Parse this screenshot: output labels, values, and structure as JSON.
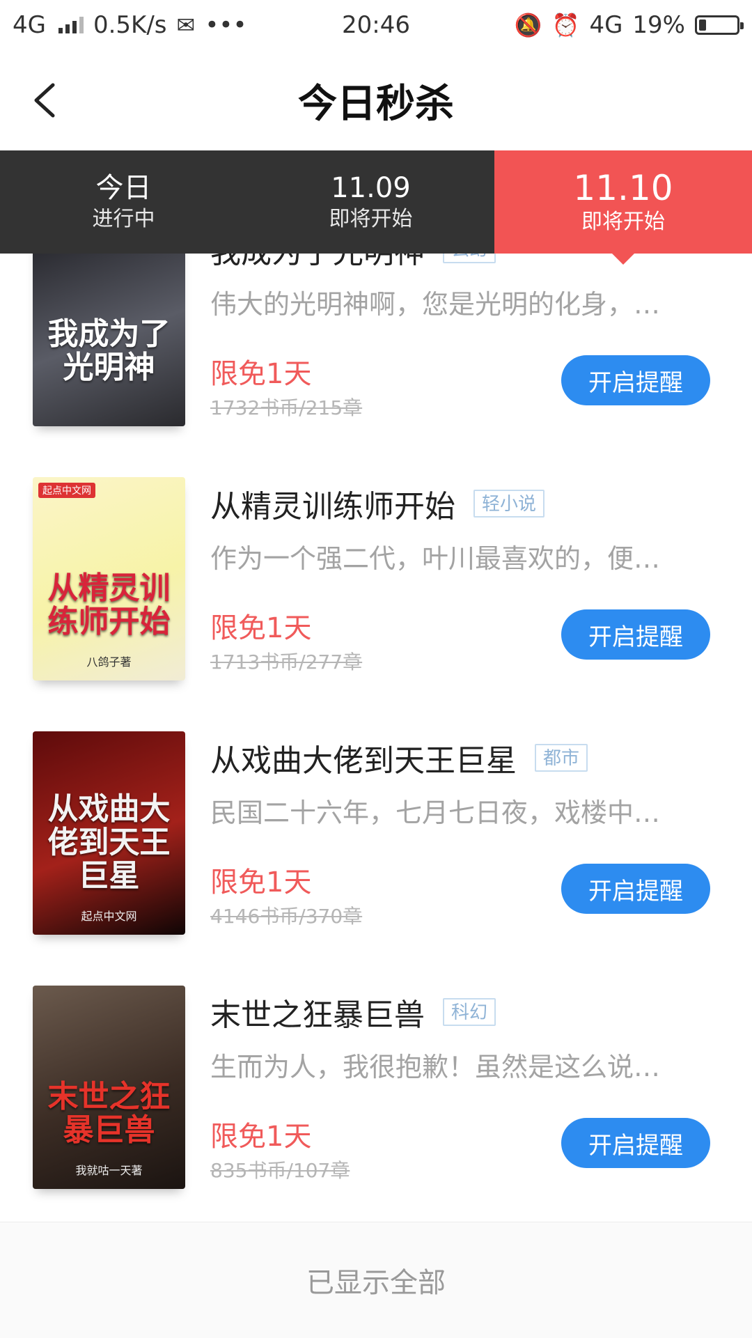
{
  "status_bar": {
    "network": "4G",
    "speed": "0.5K/s",
    "more": "•••",
    "time": "20:46",
    "network_right": "4G",
    "battery": "19%",
    "battery_level": 0.19
  },
  "header": {
    "title": "今日秒杀"
  },
  "tabs": [
    {
      "label": "今日",
      "sub": "进行中",
      "active": false
    },
    {
      "label": "11.09",
      "sub": "即将开始",
      "active": false
    },
    {
      "label": "11.10",
      "sub": "即将开始",
      "active": true
    }
  ],
  "books": [
    {
      "title": "我成为了光明神",
      "genre": "玄幻",
      "description": "伟大的光明神啊，您是光明的化身，…",
      "promo": "限免1天",
      "original": "1732书币/215章",
      "button": "开启提醒",
      "cover_text": "我成为了光明神",
      "cover_author": "",
      "cover_colors": [
        "#1f1f24",
        "#5a5c66",
        "#2a2a2e"
      ],
      "cover_text_color": "#ffffff"
    },
    {
      "title": "从精灵训练师开始",
      "genre": "轻小说",
      "description": "作为一个强二代，叶川最喜欢的，便…",
      "promo": "限免1天",
      "original": "1713书币/277章",
      "button": "开启提醒",
      "cover_text": "从精灵训练师开始",
      "cover_author": "八鸽子著",
      "cover_brand": "起点中文网",
      "cover_colors": [
        "#fbf5c8",
        "#f7f3a8",
        "#f1ecd5"
      ],
      "cover_text_color": "#d8243a"
    },
    {
      "title": "从戏曲大佬到天王巨星",
      "genre": "都市",
      "description": "民国二十六年，七月七日夜，戏楼中…",
      "promo": "限免1天",
      "original": "4146书币/370章",
      "button": "开启提醒",
      "cover_text": "从戏曲大佬到天王巨星",
      "cover_author": "起点中文网",
      "cover_colors": [
        "#5e0b0b",
        "#a3211a",
        "#0f0505"
      ],
      "cover_text_color": "#f3f3f3"
    },
    {
      "title": "末世之狂暴巨兽",
      "genre": "科幻",
      "description": "生而为人，我很抱歉！虽然是这么说…",
      "promo": "限免1天",
      "original": "835书币/107章",
      "button": "开启提醒",
      "cover_text": "末世之狂暴巨兽",
      "cover_author": "我就咕一天著",
      "cover_colors": [
        "#6b5a4d",
        "#3b2c24",
        "#1b1411"
      ],
      "cover_text_color": "#e6332a"
    }
  ],
  "footer": {
    "text": "已显示全部"
  }
}
